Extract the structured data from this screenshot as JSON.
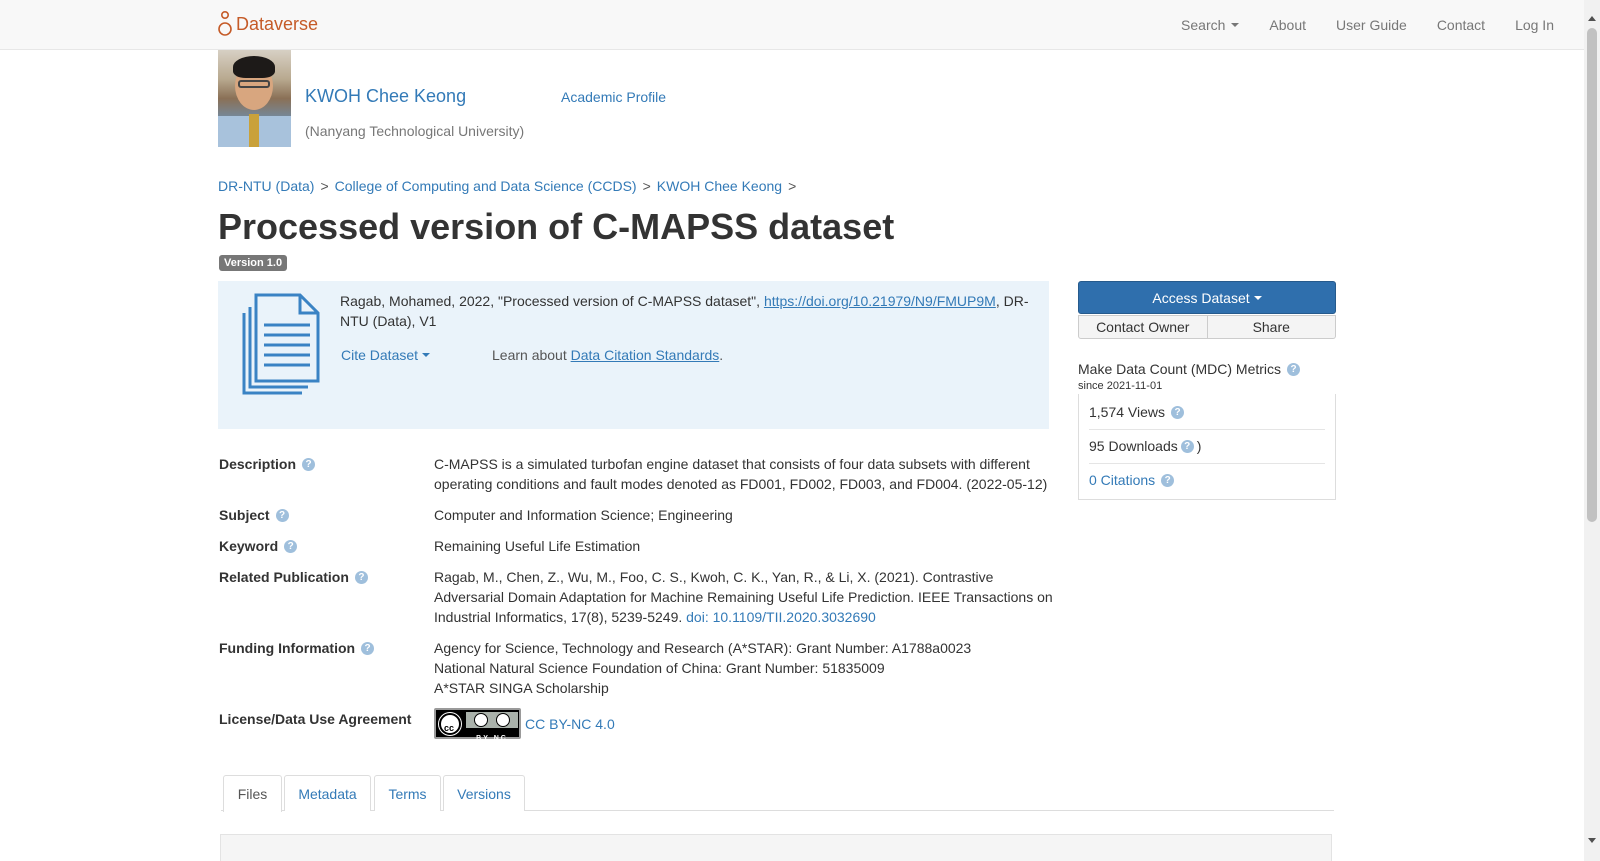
{
  "navbar": {
    "brand": "Dataverse",
    "links": [
      "Search",
      "About",
      "User Guide",
      "Contact",
      "Log In"
    ]
  },
  "profile": {
    "name": "KWOH Chee Keong",
    "affiliation": "(Nanyang Technological University)",
    "academic_profile": "Academic Profile"
  },
  "breadcrumb": [
    "DR-NTU (Data)",
    "College of Computing and Data Science (CCDS)",
    "KWOH Chee Keong"
  ],
  "breadcrumb_sep": ">",
  "dataset": {
    "title": "Processed version of C-MAPSS dataset",
    "version": "Version 1.0"
  },
  "citation": {
    "text_before": "Ragab, Mohamed, 2022, \"Processed version of C-MAPSS dataset\", ",
    "doi_link": "https://doi.org/10.21979/N9/FMUP9M",
    "text_after": ", DR-NTU (Data), V1",
    "cite_dataset": "Cite Dataset",
    "learn_prefix": "Learn about ",
    "learn_link": "Data Citation Standards",
    "learn_suffix": "."
  },
  "metadata": {
    "description_label": "Description",
    "description_value": "C-MAPSS is a simulated turbofan engine dataset that consists of four data subsets with different operating conditions and fault modes denoted as FD001, FD002, FD003, and FD004. (2022-05-12)",
    "subject_label": "Subject",
    "subject_value": "Computer and Information Science; Engineering",
    "keyword_label": "Keyword",
    "keyword_value": "Remaining Useful Life Estimation",
    "related_label": "Related Publication",
    "related_value": "Ragab, M., Chen, Z., Wu, M., Foo, C. S., Kwoh, C. K., Yan, R., & Li, X. (2021). Contrastive Adversarial Domain Adaptation for Machine Remaining Useful Life Prediction. IEEE Transactions on Industrial Informatics, 17(8), 5239-5249. ",
    "related_doi": "doi: 10.1109/TII.2020.3032690",
    "funding_label": "Funding Information",
    "funding_lines": [
      "Agency for Science, Technology and Research (A*STAR): Grant Number: A1788a0023",
      "National Natural Science Foundation of China: Grant Number: 51835009",
      "A*STAR SINGA Scholarship"
    ],
    "license_label": "License/Data Use Agreement",
    "license_badge": "BY NC",
    "license_link": "CC BY-NC 4.0"
  },
  "sidebar": {
    "access_dataset": "Access Dataset",
    "contact_owner": "Contact Owner",
    "share": "Share",
    "mdc_title": "Make Data Count (MDC) Metrics",
    "mdc_since": "since 2021-11-01",
    "views": "1,574 Views",
    "downloads": "95 Downloads",
    "downloads_suffix": ")",
    "citations": "0 Citations"
  },
  "tabs": [
    "Files",
    "Metadata",
    "Terms",
    "Versions"
  ],
  "colors": {
    "brand": "#c55b28",
    "link": "#337ab7",
    "primary_button": "#2f6fad",
    "citation_bg": "#eaf3fa"
  }
}
